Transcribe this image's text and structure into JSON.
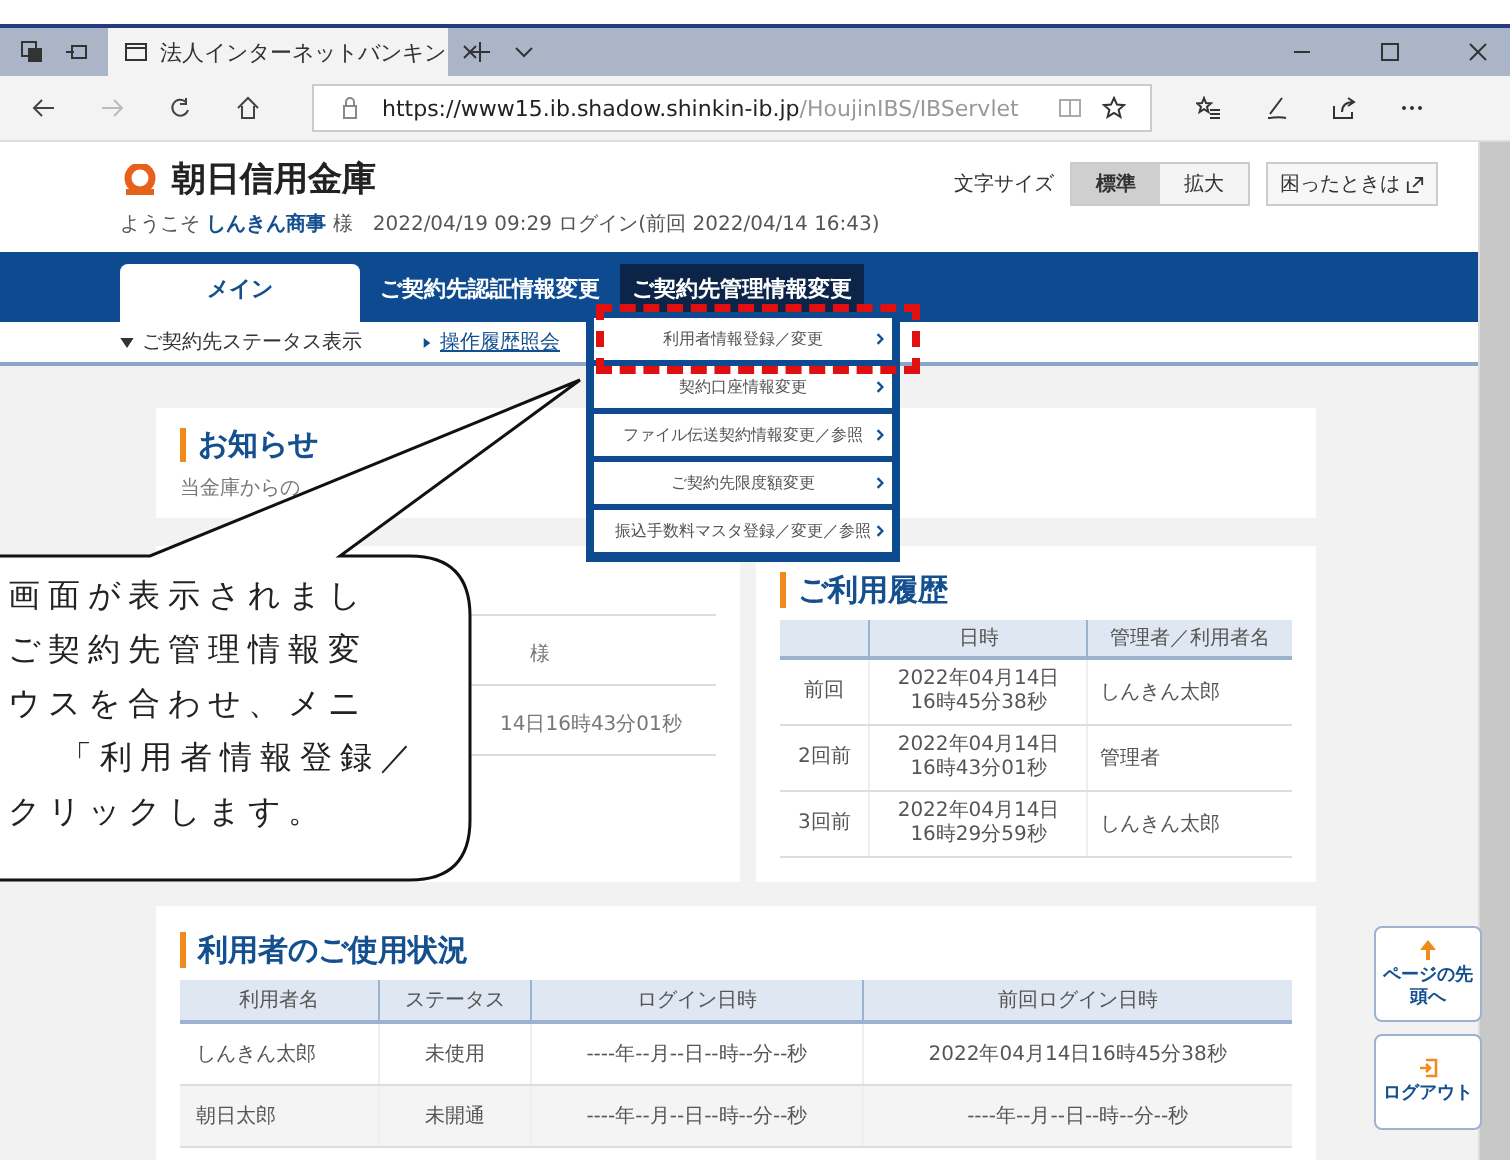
{
  "browser": {
    "tab_title": "法人インターネットバンキン",
    "url_host": "https://www15.ib.shadow.shinkin-ib.jp",
    "url_path": "/HoujinIBS/IBServlet"
  },
  "header": {
    "bank_name": "朝日信用金庫",
    "font_size_label": "文字サイズ",
    "font_sizes": [
      {
        "label": "標準",
        "selected": true
      },
      {
        "label": "拡大",
        "selected": false
      }
    ],
    "help_button": "困ったときは",
    "welcome": "ようこそ **しんきん商事** 様　2022/04/19 09:29 ログイン(前回 2022/04/14 16:43)"
  },
  "nav": {
    "tabs": [
      {
        "label": "メイン",
        "selected": true,
        "open": false
      },
      {
        "label": "ご契約先認証情報変更",
        "selected": false,
        "open": false
      },
      {
        "label": "ご契約先管理情報変更",
        "selected": false,
        "open": true
      }
    ],
    "sub_items": [
      {
        "label": "ご契約先ステータス表示",
        "kind": "toggle"
      },
      {
        "label": "操作履歴照会",
        "kind": "link"
      }
    ]
  },
  "dropdown": {
    "items": [
      {
        "label": "利用者情報登録／変更",
        "highlighted": true
      },
      {
        "label": "契約口座情報変更",
        "highlighted": false
      },
      {
        "label": "ファイル伝送契約情報変更／参照",
        "highlighted": false
      },
      {
        "label": "ご契約先限度額変更",
        "highlighted": false
      },
      {
        "label": "振込手数料マスタ登録／変更／参照",
        "highlighted": false
      }
    ]
  },
  "notice": {
    "title": "お知らせ",
    "text": "当金庫からの"
  },
  "partial_card": {
    "texts": [
      "様",
      "14日16時43分01秒"
    ]
  },
  "history": {
    "title": "ご利用履歴",
    "columns": [
      "",
      "日時",
      "管理者／利用者名"
    ],
    "rows": [
      [
        "前回",
        "2022年04月14日\n16時45分38秒",
        "しんきん太郎"
      ],
      [
        "2回前",
        "2022年04月14日\n16時43分01秒",
        "管理者"
      ],
      [
        "3回前",
        "2022年04月14日\n16時29分59秒",
        "しんきん太郎"
      ]
    ]
  },
  "usage": {
    "title": "利用者のご使用状況",
    "columns": [
      "利用者名",
      "ステータス",
      "ログイン日時",
      "前回ログイン日時"
    ],
    "rows": [
      [
        "しんきん太郎",
        "未使用",
        "----年--月--日--時--分--秒",
        "2022年04月14日16時45分38秒"
      ],
      [
        "朝日太郎",
        "未開通",
        "----年--月--日--時--分--秒",
        "----年--月--日--時--分--秒"
      ]
    ]
  },
  "side_buttons": [
    {
      "label": "ページの先頭へ",
      "kind": "top"
    },
    {
      "label": "ログアウト",
      "kind": "logout"
    }
  ],
  "callout": {
    "lines": [
      "画面が表示されまし",
      "ご契約先管理情報変",
      "ウスを合わせ、メニ",
      "「利用者情報登録／",
      "クリックします。"
    ]
  }
}
